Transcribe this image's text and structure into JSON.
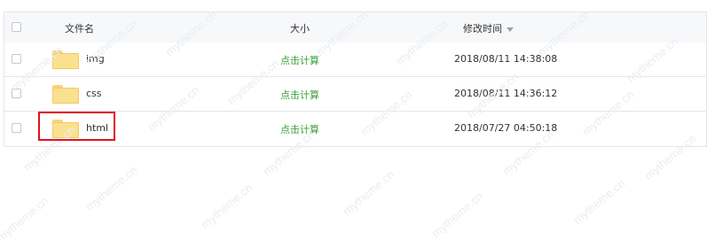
{
  "table": {
    "columns": {
      "name": "文件名",
      "size": "大小",
      "modified": "修改时间"
    },
    "rows": [
      {
        "name": "img",
        "size_action": "点击计算",
        "modified": "2018/08/11 14:38:08",
        "icon": "folder-icon"
      },
      {
        "name": "css",
        "size_action": "点击计算",
        "modified": "2018/08/11 14:36:12",
        "icon": "folder-icon"
      },
      {
        "name": "html",
        "size_action": "点击计算",
        "modified": "2018/07/27 04:50:18",
        "icon": "folder-icon",
        "highlighted": true
      }
    ]
  },
  "watermark": {
    "text": "mytheme.cn"
  },
  "colors": {
    "link": "#3aa33a",
    "highlight": "#e0141b",
    "folder": "#fbe08f",
    "border": "#e3e6ea"
  }
}
